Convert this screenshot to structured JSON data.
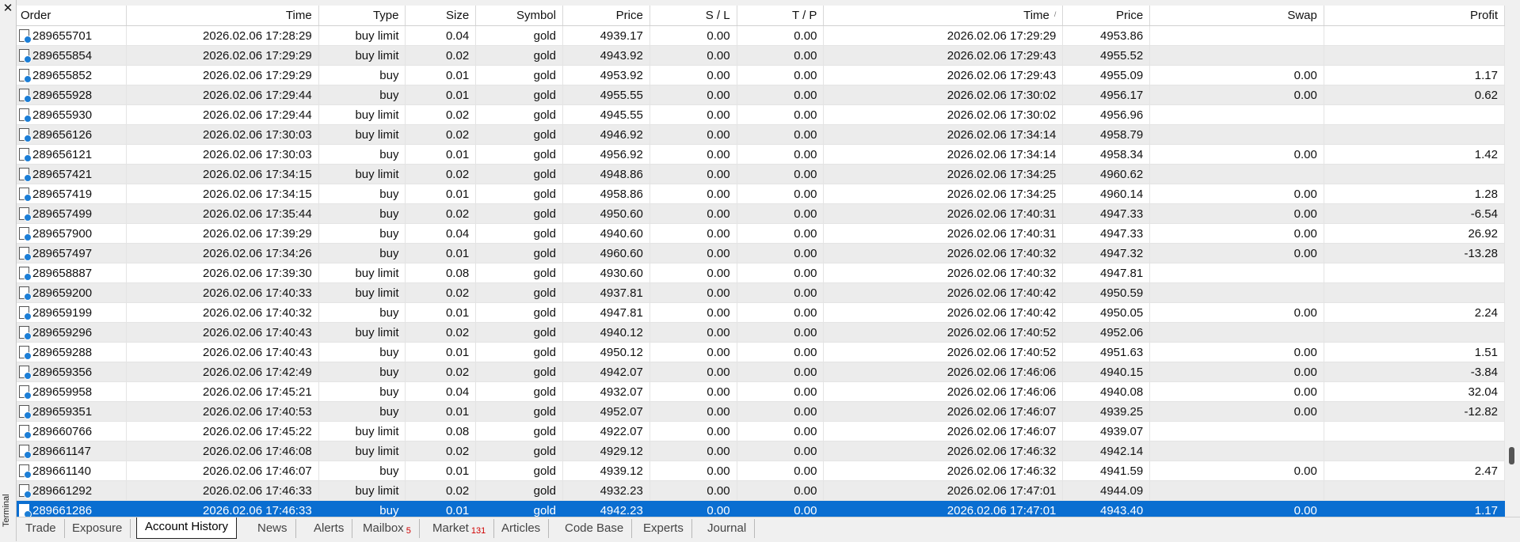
{
  "terminal_label": "Terminal",
  "close_icon": "close-icon",
  "columns": [
    "Order",
    "Time",
    "Type",
    "Size",
    "Symbol",
    "Price",
    "S / L",
    "T / P",
    "Time",
    "Price",
    "Swap",
    "Profit"
  ],
  "sort_mark": "/",
  "rows": [
    [
      "289655701",
      "2026.02.06 17:28:29",
      "buy limit",
      "0.04",
      "gold",
      "4939.17",
      "0.00",
      "0.00",
      "2026.02.06 17:29:29",
      "4953.86",
      "",
      ""
    ],
    [
      "289655854",
      "2026.02.06 17:29:29",
      "buy limit",
      "0.02",
      "gold",
      "4943.92",
      "0.00",
      "0.00",
      "2026.02.06 17:29:43",
      "4955.52",
      "",
      ""
    ],
    [
      "289655852",
      "2026.02.06 17:29:29",
      "buy",
      "0.01",
      "gold",
      "4953.92",
      "0.00",
      "0.00",
      "2026.02.06 17:29:43",
      "4955.09",
      "0.00",
      "1.17"
    ],
    [
      "289655928",
      "2026.02.06 17:29:44",
      "buy",
      "0.01",
      "gold",
      "4955.55",
      "0.00",
      "0.00",
      "2026.02.06 17:30:02",
      "4956.17",
      "0.00",
      "0.62"
    ],
    [
      "289655930",
      "2026.02.06 17:29:44",
      "buy limit",
      "0.02",
      "gold",
      "4945.55",
      "0.00",
      "0.00",
      "2026.02.06 17:30:02",
      "4956.96",
      "",
      ""
    ],
    [
      "289656126",
      "2026.02.06 17:30:03",
      "buy limit",
      "0.02",
      "gold",
      "4946.92",
      "0.00",
      "0.00",
      "2026.02.06 17:34:14",
      "4958.79",
      "",
      ""
    ],
    [
      "289656121",
      "2026.02.06 17:30:03",
      "buy",
      "0.01",
      "gold",
      "4956.92",
      "0.00",
      "0.00",
      "2026.02.06 17:34:14",
      "4958.34",
      "0.00",
      "1.42"
    ],
    [
      "289657421",
      "2026.02.06 17:34:15",
      "buy limit",
      "0.02",
      "gold",
      "4948.86",
      "0.00",
      "0.00",
      "2026.02.06 17:34:25",
      "4960.62",
      "",
      ""
    ],
    [
      "289657419",
      "2026.02.06 17:34:15",
      "buy",
      "0.01",
      "gold",
      "4958.86",
      "0.00",
      "0.00",
      "2026.02.06 17:34:25",
      "4960.14",
      "0.00",
      "1.28"
    ],
    [
      "289657499",
      "2026.02.06 17:35:44",
      "buy",
      "0.02",
      "gold",
      "4950.60",
      "0.00",
      "0.00",
      "2026.02.06 17:40:31",
      "4947.33",
      "0.00",
      "-6.54"
    ],
    [
      "289657900",
      "2026.02.06 17:39:29",
      "buy",
      "0.04",
      "gold",
      "4940.60",
      "0.00",
      "0.00",
      "2026.02.06 17:40:31",
      "4947.33",
      "0.00",
      "26.92"
    ],
    [
      "289657497",
      "2026.02.06 17:34:26",
      "buy",
      "0.01",
      "gold",
      "4960.60",
      "0.00",
      "0.00",
      "2026.02.06 17:40:32",
      "4947.32",
      "0.00",
      "-13.28"
    ],
    [
      "289658887",
      "2026.02.06 17:39:30",
      "buy limit",
      "0.08",
      "gold",
      "4930.60",
      "0.00",
      "0.00",
      "2026.02.06 17:40:32",
      "4947.81",
      "",
      ""
    ],
    [
      "289659200",
      "2026.02.06 17:40:33",
      "buy limit",
      "0.02",
      "gold",
      "4937.81",
      "0.00",
      "0.00",
      "2026.02.06 17:40:42",
      "4950.59",
      "",
      ""
    ],
    [
      "289659199",
      "2026.02.06 17:40:32",
      "buy",
      "0.01",
      "gold",
      "4947.81",
      "0.00",
      "0.00",
      "2026.02.06 17:40:42",
      "4950.05",
      "0.00",
      "2.24"
    ],
    [
      "289659296",
      "2026.02.06 17:40:43",
      "buy limit",
      "0.02",
      "gold",
      "4940.12",
      "0.00",
      "0.00",
      "2026.02.06 17:40:52",
      "4952.06",
      "",
      ""
    ],
    [
      "289659288",
      "2026.02.06 17:40:43",
      "buy",
      "0.01",
      "gold",
      "4950.12",
      "0.00",
      "0.00",
      "2026.02.06 17:40:52",
      "4951.63",
      "0.00",
      "1.51"
    ],
    [
      "289659356",
      "2026.02.06 17:42:49",
      "buy",
      "0.02",
      "gold",
      "4942.07",
      "0.00",
      "0.00",
      "2026.02.06 17:46:06",
      "4940.15",
      "0.00",
      "-3.84"
    ],
    [
      "289659958",
      "2026.02.06 17:45:21",
      "buy",
      "0.04",
      "gold",
      "4932.07",
      "0.00",
      "0.00",
      "2026.02.06 17:46:06",
      "4940.08",
      "0.00",
      "32.04"
    ],
    [
      "289659351",
      "2026.02.06 17:40:53",
      "buy",
      "0.01",
      "gold",
      "4952.07",
      "0.00",
      "0.00",
      "2026.02.06 17:46:07",
      "4939.25",
      "0.00",
      "-12.82"
    ],
    [
      "289660766",
      "2026.02.06 17:45:22",
      "buy limit",
      "0.08",
      "gold",
      "4922.07",
      "0.00",
      "0.00",
      "2026.02.06 17:46:07",
      "4939.07",
      "",
      ""
    ],
    [
      "289661147",
      "2026.02.06 17:46:08",
      "buy limit",
      "0.02",
      "gold",
      "4929.12",
      "0.00",
      "0.00",
      "2026.02.06 17:46:32",
      "4942.14",
      "",
      ""
    ],
    [
      "289661140",
      "2026.02.06 17:46:07",
      "buy",
      "0.01",
      "gold",
      "4939.12",
      "0.00",
      "0.00",
      "2026.02.06 17:46:32",
      "4941.59",
      "0.00",
      "2.47"
    ],
    [
      "289661292",
      "2026.02.06 17:46:33",
      "buy limit",
      "0.02",
      "gold",
      "4932.23",
      "0.00",
      "0.00",
      "2026.02.06 17:47:01",
      "4944.09",
      "",
      ""
    ],
    [
      "289661286",
      "2026.02.06 17:46:33",
      "buy",
      "0.01",
      "gold",
      "4942.23",
      "0.00",
      "0.00",
      "2026.02.06 17:47:01",
      "4943.40",
      "0.00",
      "1.17"
    ]
  ],
  "selected_row": 24,
  "row_icon": "order-document-icon",
  "tabs": [
    {
      "label": "Trade",
      "badge": ""
    },
    {
      "label": "Exposure",
      "badge": ""
    },
    {
      "label": "Account History",
      "badge": "",
      "active": true
    },
    {
      "label": "News",
      "badge": ""
    },
    {
      "label": "Alerts",
      "badge": ""
    },
    {
      "label": "Mailbox",
      "badge": "5"
    },
    {
      "label": "Market",
      "badge": "131"
    },
    {
      "label": "Articles",
      "badge": ""
    },
    {
      "label": "Code Base",
      "badge": ""
    },
    {
      "label": "Experts",
      "badge": ""
    },
    {
      "label": "Journal",
      "badge": ""
    }
  ],
  "colors": {
    "selection": "#0a6ed1",
    "stripe": "#ececec",
    "badge": "#d00000"
  }
}
